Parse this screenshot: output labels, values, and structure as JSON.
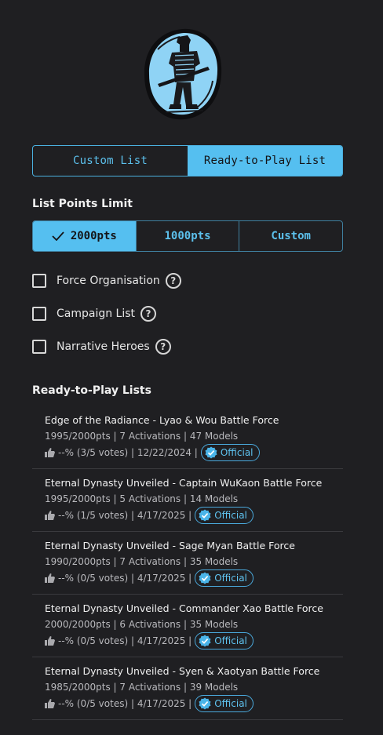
{
  "list_type_toggle": {
    "custom_label": "Custom List",
    "ready_label": "Ready-to-Play List",
    "selected": "Ready-to-Play List"
  },
  "points_limit": {
    "title": "List Points Limit",
    "options": [
      "2000pts",
      "1000pts",
      "Custom"
    ],
    "selected": "2000pts"
  },
  "options": [
    {
      "label": "Force Organisation",
      "checked": false
    },
    {
      "label": "Campaign List",
      "checked": false
    },
    {
      "label": "Narrative Heroes",
      "checked": false
    }
  ],
  "help_glyph": "?",
  "ready_lists": {
    "title": "Ready-to-Play Lists",
    "official_label": "Official",
    "items": [
      {
        "name": "Edge of the Radiance - Lyao & Wou Battle Force",
        "meta": "1995/2000pts | 7 Activations | 47 Models",
        "votes": "--% (3/5 votes) | 12/22/2024 |"
      },
      {
        "name": "Eternal Dynasty Unveiled - Captain WuKaon Battle Force",
        "meta": "1995/2000pts | 5 Activations | 14 Models",
        "votes": "--% (1/5 votes) | 4/17/2025 |"
      },
      {
        "name": "Eternal Dynasty Unveiled - Sage Myan Battle Force",
        "meta": "1990/2000pts | 7 Activations | 35 Models",
        "votes": "--% (0/5 votes) | 4/17/2025 |"
      },
      {
        "name": "Eternal Dynasty Unveiled - Commander Xao Battle Force",
        "meta": "2000/2000pts | 6 Activations | 35 Models",
        "votes": "--% (0/5 votes) | 4/17/2025 |"
      },
      {
        "name": "Eternal Dynasty Unveiled - Syen & Xaotyan Battle Force",
        "meta": "1985/2000pts | 7 Activations | 39 Models",
        "votes": "--% (0/5 votes) | 4/17/2025 |"
      }
    ]
  },
  "colors": {
    "background": "#1f1f22",
    "accent": "#55bff0",
    "accent_text": "#5cc0ec"
  }
}
